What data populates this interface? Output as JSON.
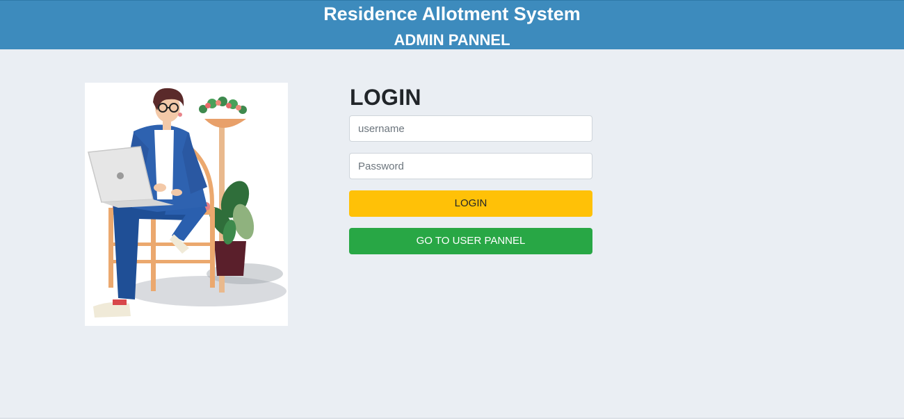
{
  "header": {
    "title": "Residence Allotment System",
    "subtitle": "ADMIN PANNEL",
    "background_color": "#3d8bbd"
  },
  "illustration": {
    "icon": "person-with-laptop-illustration"
  },
  "login_form": {
    "heading": "LOGIN",
    "username_placeholder": "username",
    "username_value": "",
    "password_placeholder": "Password",
    "password_value": "",
    "login_button": "LOGIN",
    "user_panel_button": "GO TO USER PANNEL"
  },
  "colors": {
    "page_background": "#eaeef3",
    "login_button": "#ffc107",
    "user_panel_button": "#28a745"
  }
}
